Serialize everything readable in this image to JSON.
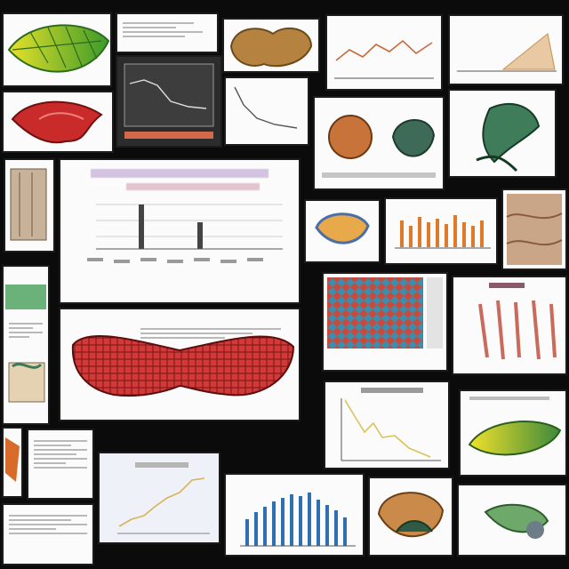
{
  "collage": {
    "description_visible_text": "",
    "accent_colors": {
      "leaf_green": "#5fae2d",
      "leaf_yellow": "#e6e12a",
      "tissue_red": "#c92a2a",
      "chart_blue": "#2f6fb3",
      "chart_orange": "#e07a2b",
      "line_yellow": "#d8c35a",
      "dark_panel": "#2c2c2c"
    }
  },
  "icons": {
    "leaf": "leaf-icon",
    "tissue": "tissue-icon",
    "chart": "chart-icon"
  }
}
